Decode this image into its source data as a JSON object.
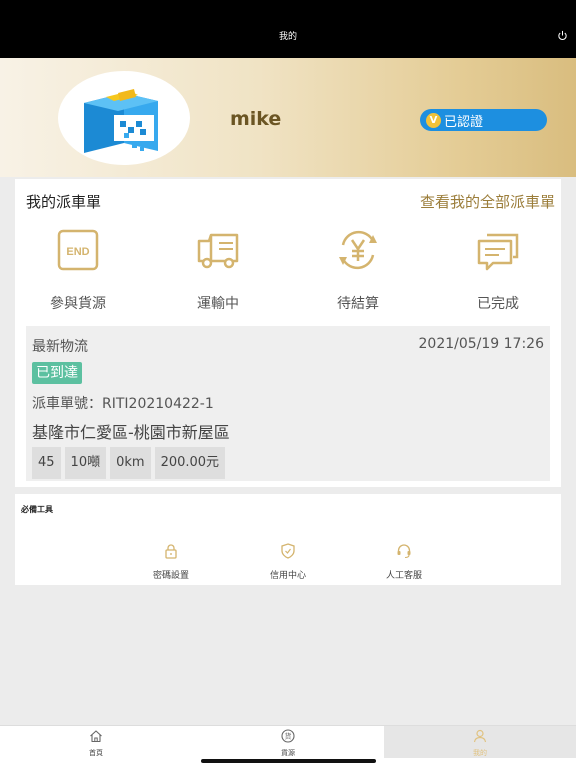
{
  "topbar": {
    "title": "我的",
    "power_icon": "power-icon"
  },
  "profile": {
    "username": "mike",
    "verify_label": "已認證",
    "verify_mark": "V",
    "avatar_icon": "box-avatar-icon"
  },
  "dispatch": {
    "title": "我的派車單",
    "view_all": "查看我的全部派車單",
    "statuses": [
      {
        "label": "參與貨源",
        "icon": "end-icon",
        "icon_text": "END"
      },
      {
        "label": "運輸中",
        "icon": "truck-icon"
      },
      {
        "label": "待結算",
        "icon": "yen-cycle-icon"
      },
      {
        "label": "已完成",
        "icon": "chat-icon"
      }
    ],
    "latest": {
      "title": "最新物流",
      "datetime": "2021/05/19 17:26",
      "badge": "已到達",
      "order_no": "派車單號：RITI20210422-1",
      "route": "基隆市仁愛區-桃園市新屋區",
      "chips": [
        "45",
        "10噸",
        "0km",
        "200.00元"
      ]
    }
  },
  "tools": {
    "title": "必備工具",
    "items": [
      {
        "label": "密碼設置",
        "icon": "lock-icon"
      },
      {
        "label": "信用中心",
        "icon": "shield-icon"
      },
      {
        "label": "人工客服",
        "icon": "headset-icon"
      }
    ]
  },
  "tabbar": {
    "tabs": [
      {
        "label": "首頁",
        "icon": "home-icon"
      },
      {
        "label": "貨源",
        "icon": "cargo-icon",
        "icon_text": "货"
      },
      {
        "label": "我的",
        "icon": "user-icon"
      }
    ],
    "active_index": 2
  },
  "colors": {
    "gold": "#d9bd7f",
    "link": "#9b7d3a",
    "badge": "#5cc0a0",
    "verify": "#1d8fe0"
  }
}
